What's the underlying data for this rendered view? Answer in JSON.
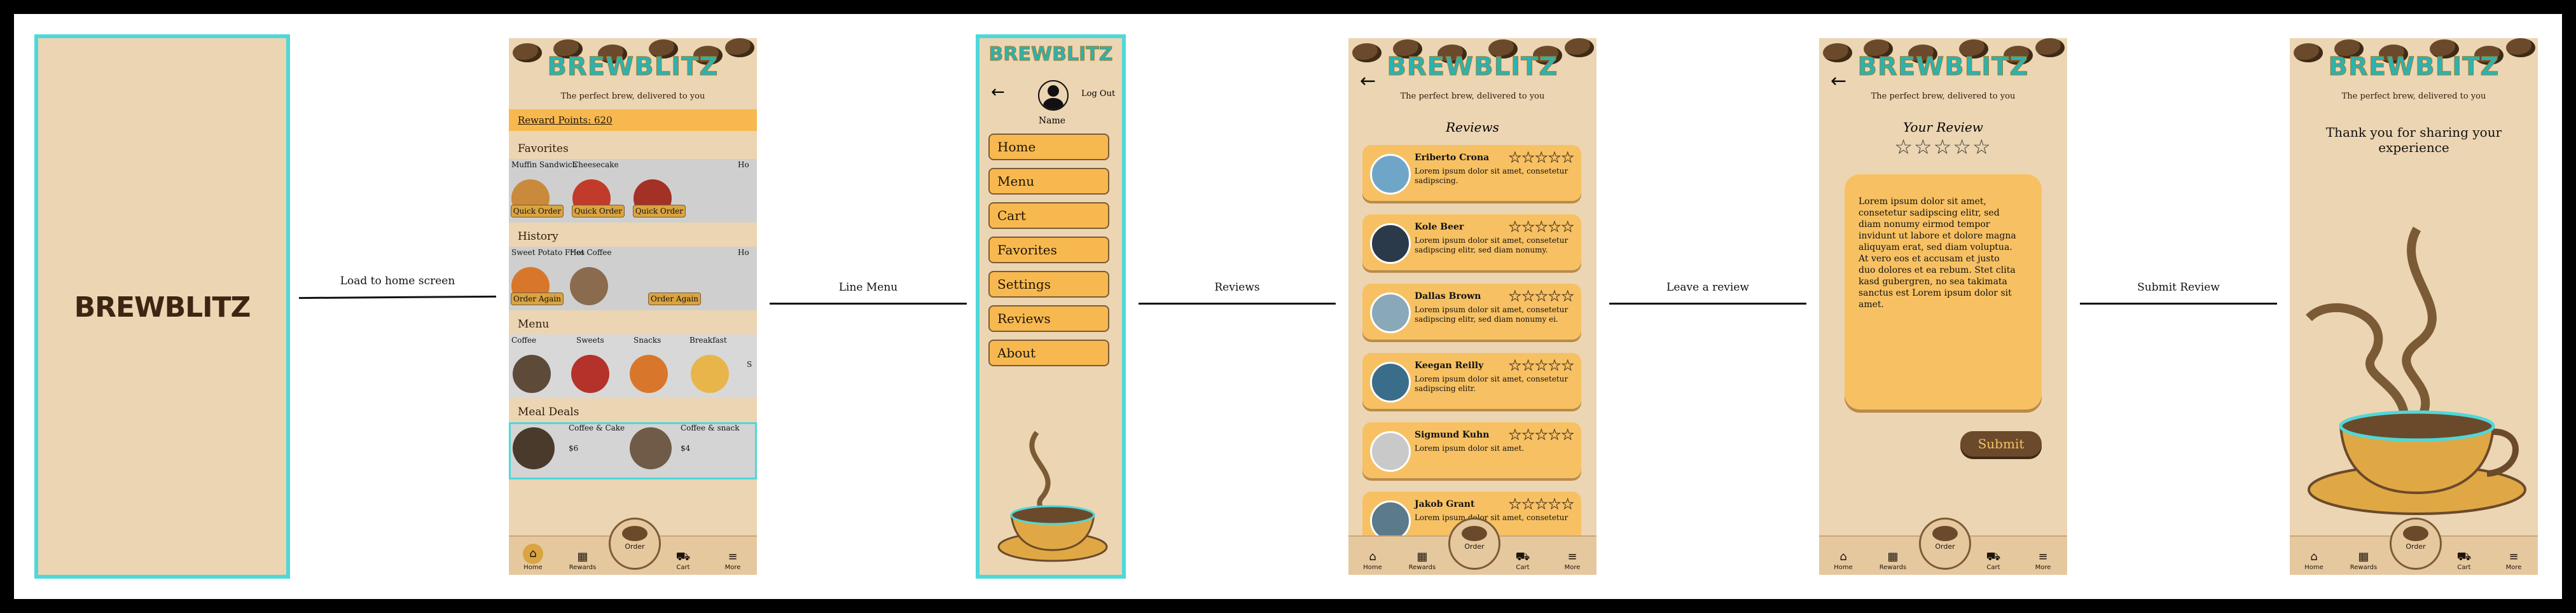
{
  "arrows": [
    {
      "label": "Load to home screen"
    },
    {
      "label": "Line Menu"
    },
    {
      "label": "Reviews"
    },
    {
      "label": "Leave a review"
    },
    {
      "label": "Submit Review"
    }
  ],
  "splash": {
    "logo": "BREWBLITZ"
  },
  "header": {
    "logo": "BREWBLITZ",
    "tagline": "The perfect brew, delivered to you"
  },
  "tabs": {
    "home": "Home",
    "rewards": "Rewards",
    "order": "Order",
    "cart": "Cart",
    "more": "More"
  },
  "home": {
    "reward_points": "Reward Points: 620",
    "favorites_title": "Favorites",
    "favorites": [
      {
        "name": "Muffin Sandwich",
        "button": "Quick Order"
      },
      {
        "name": "Cheesecake",
        "button": "Quick Order"
      },
      {
        "name": "Ho",
        "button": ""
      }
    ],
    "history_title": "History",
    "history": [
      {
        "name": "Sweet Potato Fries",
        "button": "Order Again"
      },
      {
        "name": "Hot Coffee",
        "button": "Order Again"
      },
      {
        "name": "Ho",
        "button": ""
      }
    ],
    "menu_title": "Menu",
    "menu": [
      "Coffee",
      "Sweets",
      "Snacks",
      "Breakfast",
      "S"
    ],
    "deals_title": "Meal Deals",
    "deals": [
      {
        "name": "Coffee & Cake",
        "price": "$6"
      },
      {
        "name": "Coffee & snack",
        "price": "$4"
      }
    ]
  },
  "menu_screen": {
    "logo": "BREWBLITZ",
    "logout": "Log Out",
    "profile_name": "Name",
    "items": [
      "Home",
      "Menu",
      "Cart",
      "Favorites",
      "Settings",
      "Reviews",
      "About"
    ]
  },
  "reviews": {
    "title": "Reviews",
    "stars": "★★★★★",
    "list": [
      {
        "name": "Eriberto Crona",
        "text": "Lorem ipsum dolor sit amet, consetetur sadipscing."
      },
      {
        "name": "Kole Beer",
        "text": "Lorem ipsum dolor sit amet, consetetur sadipscing elitr, sed diam nonumy."
      },
      {
        "name": "Dallas Brown",
        "text": "Lorem ipsum dolor sit amet, consetetur sadipscing elitr, sed diam nonumy ei."
      },
      {
        "name": "Keegan Reilly",
        "text": "Lorem ipsum dolor sit amet, consetetur sadipscing elitr."
      },
      {
        "name": "Sigmund Kuhn",
        "text": "Lorem ipsum dolor sit amet."
      },
      {
        "name": "Jakob Grant",
        "text": "Lorem ipsum dolor sit amet, consetetur"
      }
    ]
  },
  "your_review": {
    "title": "Your Review",
    "stars": "☆☆☆☆☆",
    "body": "Lorem ipsum dolor sit amet, consetetur sadipscing elitr, sed diam nonumy eirmod tempor invidunt ut labore et dolore magna aliquyam erat, sed diam voluptua. At vero eos et accusam et justo duo dolores et ea rebum. Stet clita kasd gubergren, no sea takimata sanctus est Lorem ipsum dolor sit amet.",
    "submit": "Submit"
  },
  "thanks": {
    "message": "Thank you for sharing your experience"
  }
}
